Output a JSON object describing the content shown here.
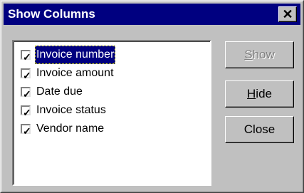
{
  "window": {
    "title": "Show Columns",
    "close_glyph": "✕"
  },
  "list": {
    "items": [
      {
        "label": "Invoice number",
        "checked": true,
        "selected": true
      },
      {
        "label": "Invoice amount",
        "checked": true,
        "selected": false
      },
      {
        "label": "Date due",
        "checked": true,
        "selected": false
      },
      {
        "label": "Invoice status",
        "checked": true,
        "selected": false
      },
      {
        "label": "Vendor name",
        "checked": true,
        "selected": false
      }
    ]
  },
  "buttons": {
    "show": {
      "mnemonic": "S",
      "rest": "how",
      "enabled": false
    },
    "hide": {
      "mnemonic": "H",
      "rest": "ide",
      "enabled": true
    },
    "close": {
      "label": "Close",
      "enabled": true
    }
  },
  "colors": {
    "face": "#c0c0c0",
    "titlebar": "#000080",
    "selection": "#000080"
  }
}
